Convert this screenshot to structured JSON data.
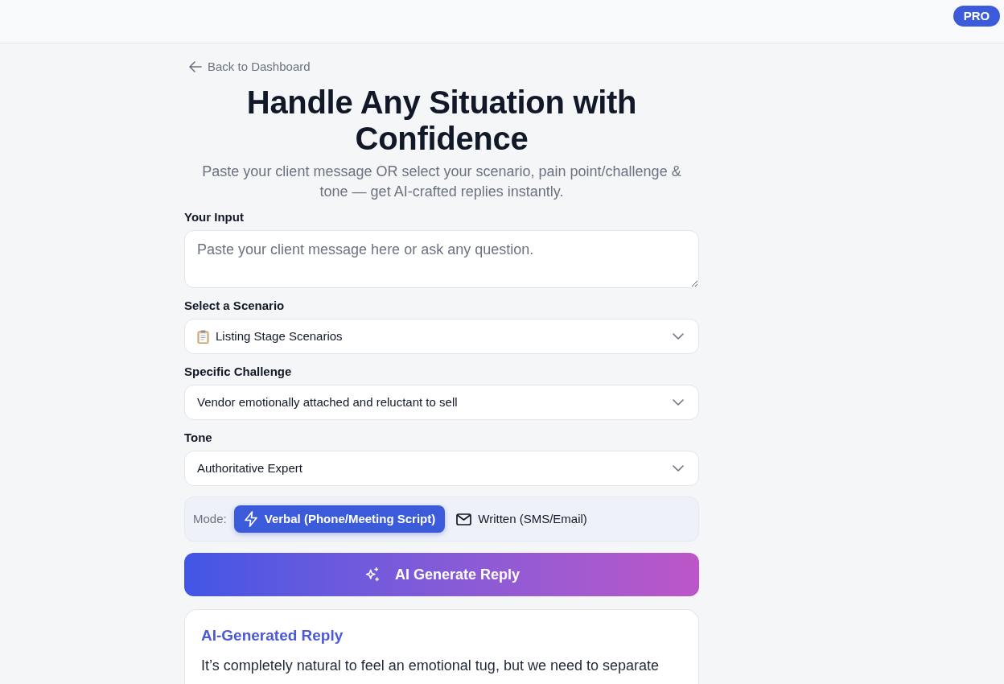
{
  "header": {
    "badge": "PRO"
  },
  "back_link": {
    "label": "Back to Dashboard"
  },
  "title": "Handle Any Situation with Confidence",
  "subtitle": "Paste your client message OR select your scenario, pain point/challenge & tone — get AI-crafted replies instantly.",
  "input": {
    "label": "Your Input",
    "placeholder": "Paste your client message here or ask any question."
  },
  "selects": [
    {
      "label": "Select a Scenario",
      "value": "Listing Stage Scenarios"
    },
    {
      "label": "Specific Challenge",
      "value": "Vendor emotionally attached and reluctant to sell"
    },
    {
      "label": "Tone",
      "value": "Authoritative Expert"
    }
  ],
  "mode": {
    "label": "Mode:",
    "options": [
      {
        "label": "Verbal (Phone/Meeting Script)",
        "selected": true
      },
      {
        "label": "Written (SMS/Email)",
        "selected": false
      }
    ]
  },
  "generate_button": {
    "label": "AI Generate Reply"
  },
  "reply": {
    "title": "AI-Generated Reply",
    "text": "It’s completely natural to feel an emotional tug, but we need to separate"
  }
}
